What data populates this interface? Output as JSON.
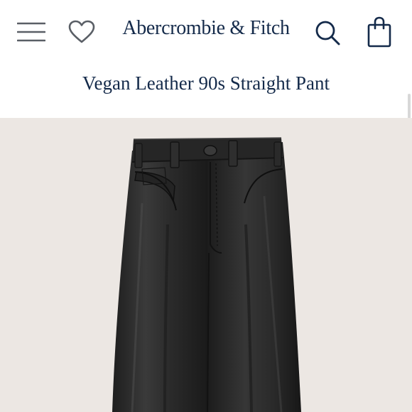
{
  "header": {
    "brand_name": "Abercrombie & Fitch",
    "menu_icon": "hamburger-menu-icon",
    "wishlist_icon": "heart-icon",
    "search_icon": "search-icon",
    "bag_icon": "shopping-bag-icon"
  },
  "product": {
    "title": "Vegan Leather 90s Straight Pant",
    "image_subject": "black vegan leather straight pants",
    "image_background": "#ece7e3",
    "pant_color": "#2a2a2a"
  },
  "colors": {
    "brand_navy": "#142a4a",
    "icon_gray": "#5a5f66"
  }
}
